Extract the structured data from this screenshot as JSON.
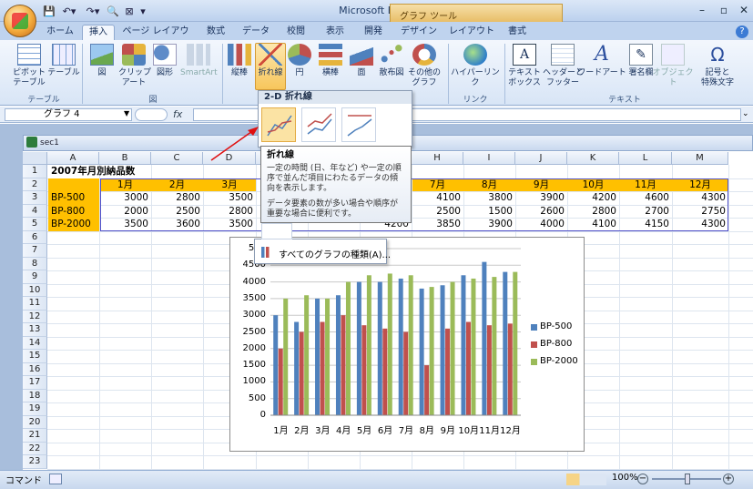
{
  "app_title": "Microsoft Excel",
  "context_tools": "グラフ ツール",
  "tabs": [
    "ホーム",
    "挿入",
    "ページ レイアウト",
    "数式",
    "データ",
    "校閲",
    "表示",
    "開発",
    "デザイン",
    "レイアウト",
    "書式"
  ],
  "ribbon": {
    "pivot": "ピボット\nテーブル",
    "table": "テーブル",
    "picture": "図",
    "clipart": "クリップ\nアート",
    "shapes": "図形",
    "smartart": "SmartArt",
    "column": "縦棒",
    "line": "折れ線",
    "pie": "円",
    "bar": "横棒",
    "area": "面",
    "scatter": "散布図",
    "other": "その他の\nグラフ",
    "hyperlink": "ハイパーリンク",
    "textbox": "テキスト\nボックス",
    "headerfooter": "ヘッダーと\nフッター",
    "wordart": "ワードアート",
    "signature": "署名欄",
    "object": "オブジェクト",
    "symbol": "記号と\n特殊文字",
    "group_table": "テーブル",
    "group_illust": "図",
    "group_link": "リンク",
    "group_text": "テキスト"
  },
  "namebox": "グラフ 4",
  "fx": "fx",
  "sheet_window": "sec1",
  "dropdown": {
    "header": "2-D 折れ線",
    "all_types": "すべてのグラフの種類(A)..."
  },
  "tooltip": {
    "title": "折れ線",
    "line1": "一定の時間 (日、年など) や一定の順序で並んだ項目にわたるデータの傾向を表示します。",
    "line2": "データ要素の数が多い場合や順序が重要な場合に便利です。"
  },
  "columns": [
    "A",
    "B",
    "C",
    "D",
    "E",
    "F",
    "G",
    "H",
    "I",
    "J",
    "K",
    "L",
    "M"
  ],
  "rows": [
    "1",
    "2",
    "3",
    "4",
    "5",
    "6",
    "7",
    "8",
    "9",
    "10",
    "11",
    "12",
    "13",
    "14",
    "15",
    "16",
    "17",
    "18",
    "19",
    "20",
    "21",
    "22",
    "23"
  ],
  "sheet": {
    "title": "2007年月別納品数",
    "header_visible": [
      "1月",
      "2月",
      "3月",
      "7月",
      "8月",
      "9月",
      "10月",
      "11月",
      "12月"
    ],
    "r3": {
      "label": "BP-500",
      "v": [
        "3000",
        "2800",
        "3500",
        "4100",
        "3800",
        "3900",
        "4200",
        "4600",
        "4300"
      ]
    },
    "r4": {
      "label": "BP-800",
      "v": [
        "2000",
        "2500",
        "2800",
        "2500",
        "1500",
        "2600",
        "2800",
        "2700",
        "2750"
      ]
    },
    "r5": {
      "label": "BP-2000",
      "v": [
        "3500",
        "3600",
        "3500",
        "4200",
        "3850",
        "3900",
        "4000",
        "4100",
        "4150",
        "4300"
      ]
    }
  },
  "status": {
    "mode": "コマンド",
    "zoom": "100%"
  },
  "colors": {
    "s1": "#4f81bd",
    "s2": "#c0504d",
    "s3": "#9bbb59",
    "header_fill": "#ffc000"
  },
  "chart_data": {
    "type": "bar",
    "categories": [
      "1月",
      "2月",
      "3月",
      "4月",
      "5月",
      "6月",
      "7月",
      "8月",
      "9月",
      "10月",
      "11月",
      "12月"
    ],
    "series": [
      {
        "name": "BP-500",
        "values": [
          3000,
          2800,
          3500,
          3600,
          4000,
          4000,
          4100,
          3800,
          3900,
          4200,
          4600,
          4300
        ]
      },
      {
        "name": "BP-800",
        "values": [
          2000,
          2500,
          2800,
          3000,
          2700,
          2600,
          2500,
          1500,
          2600,
          2800,
          2700,
          2750
        ]
      },
      {
        "name": "BP-2000",
        "values": [
          3500,
          3600,
          3500,
          4000,
          4200,
          4250,
          4200,
          3850,
          4000,
          4100,
          4150,
          4300
        ]
      }
    ],
    "yticks": [
      "0",
      "500",
      "1000",
      "1500",
      "2000",
      "2500",
      "3000",
      "3500",
      "4000",
      "4500",
      "500"
    ],
    "ylim": [
      0,
      5000
    ],
    "legend": "right"
  }
}
